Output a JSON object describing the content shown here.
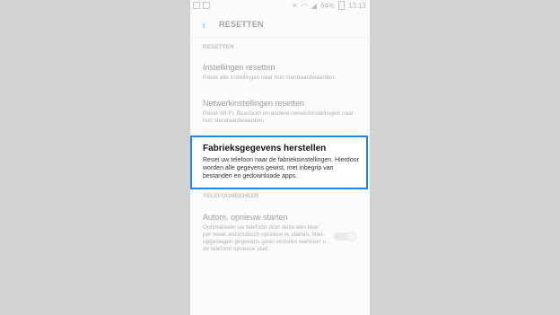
{
  "statusbar": {
    "battery": "64%",
    "time": "13:13"
  },
  "appbar": {
    "title": "RESETTEN"
  },
  "main": {
    "section1_header": "RESETTEN",
    "items": [
      {
        "title": "Instellingen resetten",
        "description": "Reset alle instellingen naar hun standaardwaarden."
      },
      {
        "title": "Netwerkinstellingen resetten",
        "description": "Reset Wi-Fi, Bluetooth en andere netwerkinstellingen naar hun standaardwaarden."
      },
      {
        "title": "Fabrieksgegevens herstellen",
        "description": "Reset uw telefoon naar de fabrieksinstellingen. Hierdoor worden alle gegevens gewist, met inbegrip van bestanden en gedownloade apps."
      }
    ],
    "section2_header": "TELEFOONBEHEER",
    "auto_restart": {
      "title": "Autom. opnieuw starten",
      "description": "Optimaliseer uw telefoon door deze één keer per week automatisch opnieuw te starten. Niet-opgeslagen gegevens gaan verloren wanneer u de telefoon opnieuw start.",
      "enabled": false
    }
  },
  "colors": {
    "accent": "#1e88e5"
  }
}
